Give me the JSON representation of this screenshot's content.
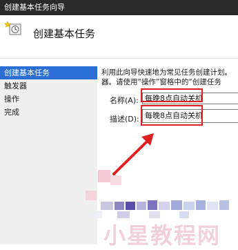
{
  "window": {
    "title": "创建基本任务向导"
  },
  "header": {
    "title": "创建基本任务",
    "icon": "task-wizard-icon"
  },
  "sidebar": {
    "items": [
      {
        "label": "创建基本任务",
        "active": true
      },
      {
        "label": "触发器",
        "active": false
      },
      {
        "label": "操作",
        "active": false
      },
      {
        "label": "完成",
        "active": false
      }
    ]
  },
  "main": {
    "description_line1": "利用此向导快速地为常见任务创建计划。",
    "description_line2": "器。请使用“操作”窗格中的“创建任务",
    "name_label": "名称(A):",
    "name_value": "每晚8点自动关机",
    "desc_label": "描述(D):",
    "desc_value": "每晚8点自动关机"
  },
  "overlay": {
    "annotation_color": "#e02020",
    "watermark_text": "小星教程网"
  }
}
